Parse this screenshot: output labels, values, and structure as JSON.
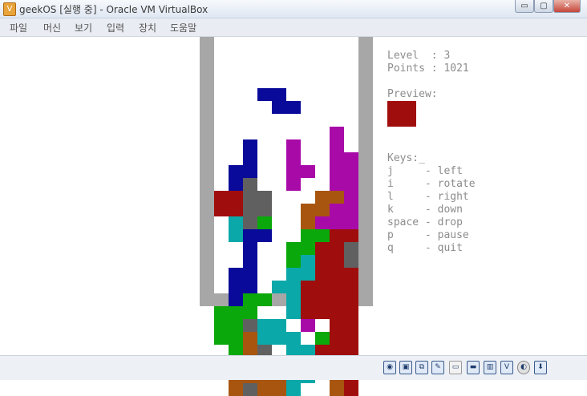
{
  "window": {
    "title": "geekOS [실행 중] - Oracle VM VirtualBox"
  },
  "window_controls": {
    "minimize": "▭",
    "maximize": "▢",
    "close": "✕"
  },
  "menu": {
    "items": [
      "파일",
      "머신",
      "보기",
      "입력",
      "장치",
      "도움말"
    ]
  },
  "game": {
    "level_line": "Level  : 3",
    "points_line": "Points : 1021",
    "preview_label": "Preview:",
    "keys_label": "Keys:_",
    "keys": [
      "j     - left",
      "i     - rotate",
      "l     - right",
      "k     - down",
      "space - drop",
      "p     - pause",
      "q     - quit"
    ],
    "preview_color": "#a00d0d",
    "colors": {
      "B": "#0a0a9a",
      "M": "#a80aa8",
      "R": "#a00d0d",
      "D": "#606060",
      "G": "#0aa80a",
      "C": "#0aa8a8",
      "O": "#a85510"
    },
    "grid": [
      "..........",
      "..........",
      "..........",
      "..........",
      "...BB.....",
      "....BB....",
      "..........",
      "........M.",
      "..B..M..M.",
      "..B..M..MM",
      ".BB..MM.MM",
      ".BD..M..MM",
      "RRDD...OOM",
      "RRDD..OOMM",
      ".CDG..OMMM",
      ".CBB..GGRR",
      "..B..GGRRD",
      "..B..GCRRD",
      ".BB..CCRRR",
      ".BB.CCRRRR",
      ".BGG.CRRRR",
      "GGG..CRRRR",
      "GGDCC.M.RR",
      "GGOCCC.GRR",
      ".GOD.CCRRR",
      ".OOOCCC.OR",
      ".OOOOCC.OR",
      ".ODOOC..OR"
    ]
  },
  "statusbar": {
    "icons": [
      "hdd-icon",
      "floppy-icon",
      "network-icon",
      "usb-icon",
      "shared-folder-icon",
      "display-icon",
      "capture-icon",
      "vbox-icon",
      "disk-icon",
      "keyboard-icon"
    ]
  }
}
